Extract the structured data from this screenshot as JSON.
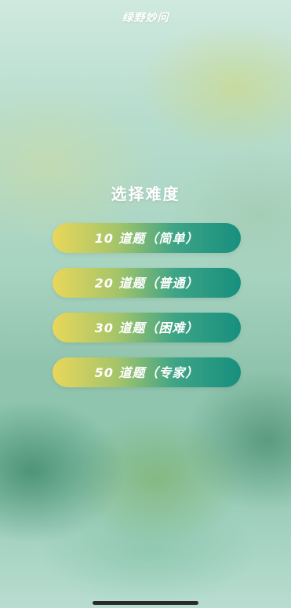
{
  "app": {
    "title": "绿野妙问"
  },
  "main": {
    "heading": "选择难度",
    "options": [
      {
        "label": "10 道题（简单）"
      },
      {
        "label": "20 道题（普通）"
      },
      {
        "label": "30 道题（困难）"
      },
      {
        "label": "50 道题（专家）"
      }
    ]
  },
  "colors": {
    "button_gradient_start": "#e9d75a",
    "button_gradient_end": "#178f7e",
    "text": "#ffffff"
  }
}
